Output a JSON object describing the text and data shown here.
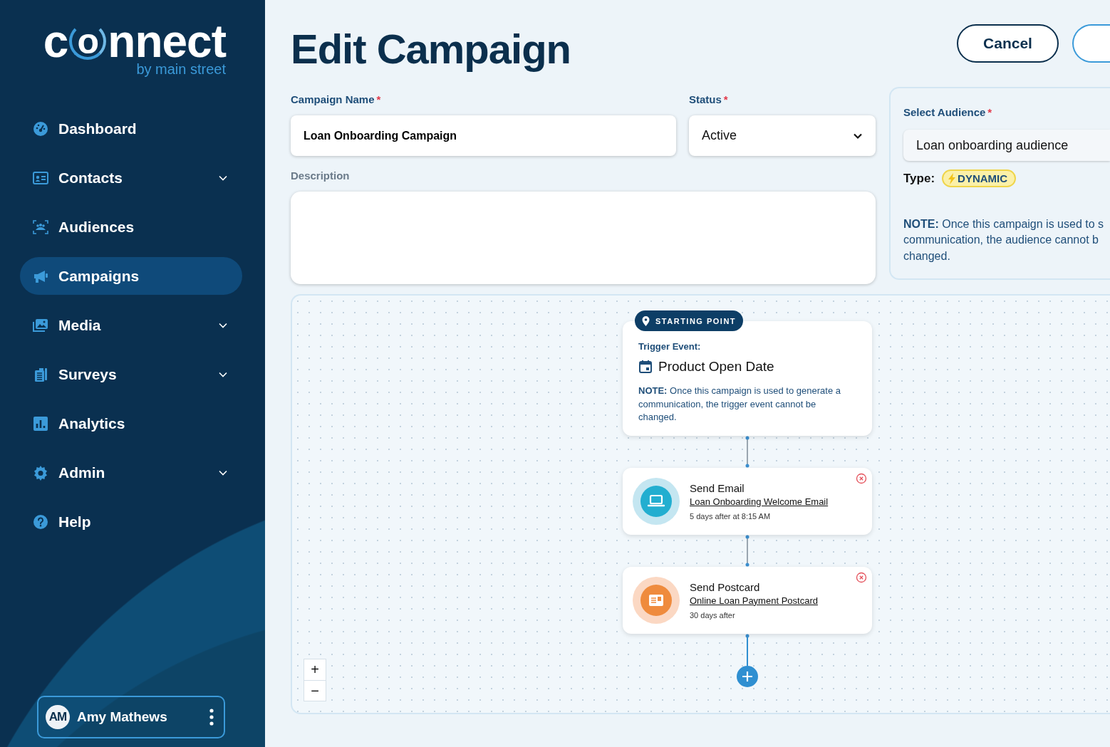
{
  "brand": {
    "logo": [
      "c",
      "o",
      "nnect"
    ],
    "tagline": "by main street"
  },
  "nav": [
    {
      "label": "Dashboard",
      "expandable": false,
      "selected": false
    },
    {
      "label": "Contacts",
      "expandable": true,
      "selected": false
    },
    {
      "label": "Audiences",
      "expandable": false,
      "selected": false
    },
    {
      "label": "Campaigns",
      "expandable": false,
      "selected": true
    },
    {
      "label": "Media",
      "expandable": true,
      "selected": false
    },
    {
      "label": "Surveys",
      "expandable": true,
      "selected": false
    },
    {
      "label": "Analytics",
      "expandable": false,
      "selected": false
    },
    {
      "label": "Admin",
      "expandable": true,
      "selected": false
    },
    {
      "label": "Help",
      "expandable": false,
      "selected": false
    }
  ],
  "user": {
    "initials": "AM",
    "name": "Amy Mathews"
  },
  "page": {
    "title": "Edit Campaign",
    "buttons": [
      {
        "label": "Cancel",
        "kind": "secondary"
      },
      {
        "kind": "primary"
      }
    ]
  },
  "form": {
    "name": {
      "label": "Campaign Name",
      "mark": "*",
      "value": "Loan Onboarding Campaign"
    },
    "status": {
      "label": "Status",
      "mark": "*",
      "value": "Active"
    },
    "description": {
      "label": "Description"
    }
  },
  "audience": {
    "label": "Select Audience",
    "mark": "*",
    "value": "Loan onboarding audience",
    "type_label": "Type:",
    "type_badge": "DYNAMIC",
    "note": "**NOTE:** Once this campaign is used to s\ncommunication, the audience cannot b\nchanged."
  },
  "flow": {
    "start": {
      "badge": "STARTING POINT",
      "trigger_label": "Trigger Event:",
      "trigger": "Product Open Date",
      "note": "**NOTE:** Once this campaign is used to generate a communication, the trigger event cannot be changed."
    },
    "steps": [
      {
        "kind": "email",
        "title": "Send Email",
        "link": "Loan Onboarding Welcome Email",
        "timing": "5 days after at 8:15 AM"
      },
      {
        "kind": "postcard",
        "title": "Send Postcard",
        "link": "Online Loan Payment Postcard",
        "timing": "30 days after"
      }
    ],
    "zoom": [
      "+",
      "−"
    ]
  }
}
